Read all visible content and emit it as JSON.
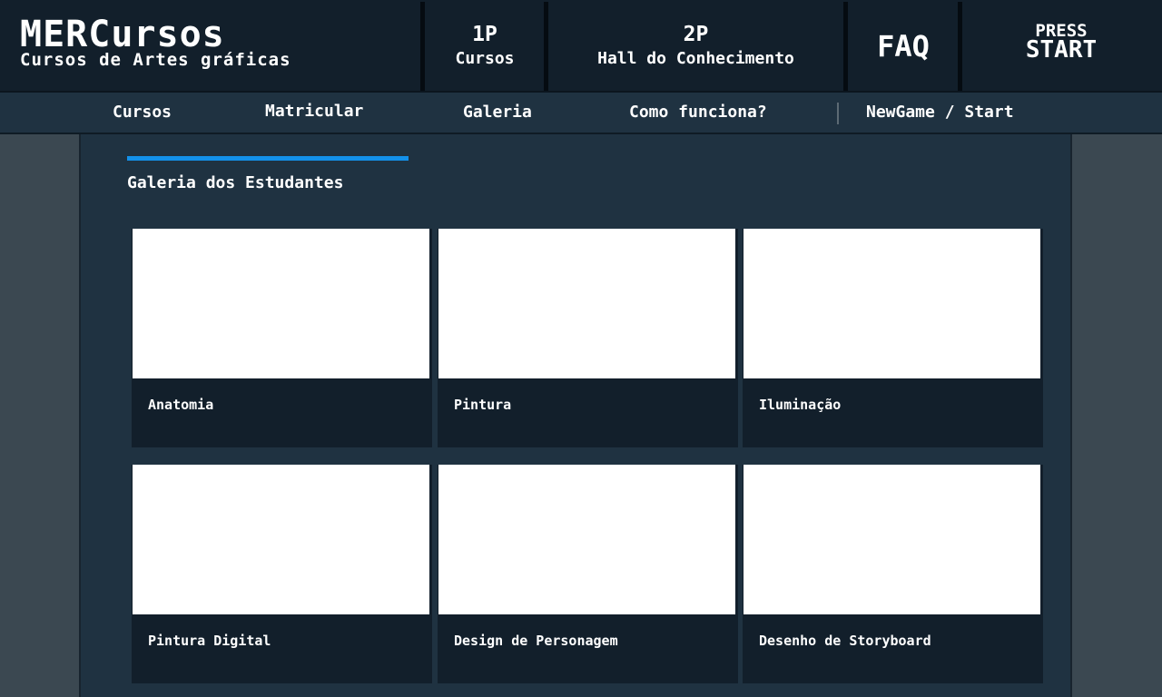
{
  "brand": {
    "title": "MERCursos",
    "subtitle": "Cursos de Artes gráficas"
  },
  "header_buttons": {
    "p1": {
      "line1": "1P",
      "line2": "Cursos"
    },
    "p2": {
      "line1": "2P",
      "line2": "Hall do Conhecimento"
    },
    "faq": {
      "label": "FAQ"
    },
    "press": {
      "line1": "PRESS",
      "line2": "START"
    }
  },
  "nav": {
    "items": [
      {
        "label": "Cursos"
      },
      {
        "label": "Matricular"
      },
      {
        "label": "Galeria"
      },
      {
        "label": "Como funciona?"
      },
      {
        "label": "NewGame / Start"
      }
    ]
  },
  "section": {
    "title": "Galeria dos Estudantes"
  },
  "gallery": [
    {
      "caption": "Anatomia"
    },
    {
      "caption": "Pintura"
    },
    {
      "caption": "Iluminação"
    },
    {
      "caption": "Pintura Digital"
    },
    {
      "caption": "Design de Personagem"
    },
    {
      "caption": "Desenho de Storyboard"
    }
  ],
  "colors": {
    "accent": "#1391ea",
    "header_bg": "#121f2b",
    "panel_bg": "#1f3241",
    "page_bg": "#3b4851"
  }
}
